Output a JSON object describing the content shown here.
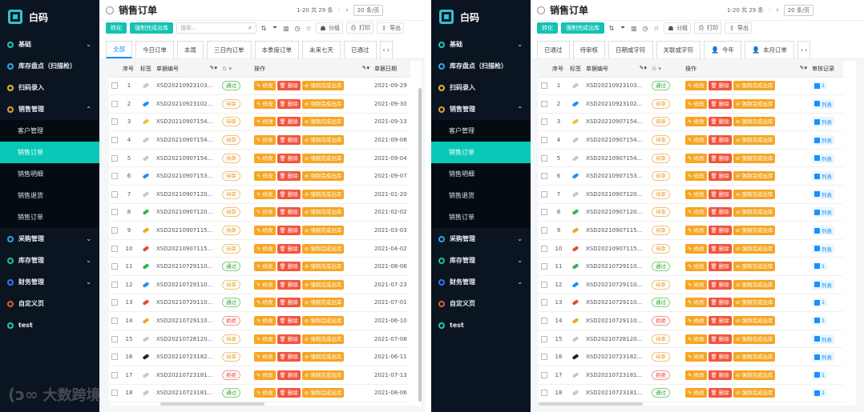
{
  "app": {
    "name": "白码"
  },
  "sidebar": {
    "items": [
      {
        "label": "基础",
        "color": "#23c4c4",
        "chev": "⌄"
      },
      {
        "label": "库存盘点（扫描枪）",
        "color": "#2aa9f0",
        "chev": ""
      },
      {
        "label": "扫码录入",
        "color": "#f0b52a",
        "chev": ""
      },
      {
        "label": "销售管理",
        "color": "#f09a2a",
        "chev": "⌃"
      }
    ],
    "subitems": [
      {
        "label": "客户管理"
      },
      {
        "label": "销售订单"
      },
      {
        "label": "销售明细"
      },
      {
        "label": "销售退货"
      },
      {
        "label": "销售订单"
      }
    ],
    "items2": [
      {
        "label": "采购管理",
        "color": "#2aa9f0",
        "chev": "⌄"
      },
      {
        "label": "库存管理",
        "color": "#23c48a",
        "chev": "⌄"
      },
      {
        "label": "财务管理",
        "color": "#2a7af0",
        "chev": "⌄"
      },
      {
        "label": "自定义页",
        "color": "#f0552a",
        "chev": ""
      },
      {
        "label": "test",
        "color": "#23c4c4",
        "chev": ""
      }
    ]
  },
  "header": {
    "title": "销售订单"
  },
  "pager": {
    "range": "1-20 共 29 条",
    "size": "20 条/页"
  },
  "toolbar": {
    "btn1": "转化",
    "btn2": "强制完成出库",
    "search_placeholder": "搜索...",
    "group": "分组",
    "print": "打印",
    "export": "导出"
  },
  "tabs_left": [
    "全部",
    "今日订单",
    "本周",
    "三日内订单",
    "本季度订单",
    "未来七天",
    "已通过"
  ],
  "tabs_right": [
    "已通过",
    "待审核",
    "日期或字符",
    "关联或字符",
    "今年",
    "本月订单"
  ],
  "columns": {
    "seq": "序号",
    "tag": "标签",
    "no": "单据编号",
    "status": "",
    "ops": "操作",
    "date": "单据日期",
    "audit": "审核记录"
  },
  "actions": {
    "edit": "修改",
    "del": "删除",
    "force": "强制完成出库"
  },
  "statuses": {
    "pass": "通过",
    "pend": "待审",
    "rej": "拒绝"
  },
  "rows": [
    {
      "seq": "1",
      "tag": "#c9c9c9",
      "no": "XSD20210923103...",
      "status": "通过",
      "st": "pass",
      "date": "2021-09-29",
      "audit": "1"
    },
    {
      "seq": "2",
      "tag": "#1890ff",
      "no": "XSD20210923102...",
      "status": "待审",
      "st": "pend",
      "date": "2021-09-30",
      "audit": "列表"
    },
    {
      "seq": "3",
      "tag": "#f0c040",
      "no": "XSD20210907154...",
      "status": "待审",
      "st": "pend",
      "date": "2021-09-13",
      "audit": "列表"
    },
    {
      "seq": "4",
      "tag": "#c9c9c9",
      "no": "XSD20210907154...",
      "status": "待审",
      "st": "pend",
      "date": "2021-09-08",
      "audit": "列表"
    },
    {
      "seq": "5",
      "tag": "#c9c9c9",
      "no": "XSD20210907154...",
      "status": "待审",
      "st": "pend",
      "date": "2021-09-04",
      "audit": "列表"
    },
    {
      "seq": "6",
      "tag": "#1890ff",
      "no": "XSD20210907153...",
      "status": "待审",
      "st": "pend",
      "date": "2021-09-07",
      "audit": "列表"
    },
    {
      "seq": "7",
      "tag": "#c9c9c9",
      "no": "XSD20210907120...",
      "status": "待审",
      "st": "pend",
      "date": "2021-01-20",
      "audit": "列表"
    },
    {
      "seq": "8",
      "tag": "#34b34a",
      "no": "XSD20210907120...",
      "status": "待审",
      "st": "pend",
      "date": "2021-02-02",
      "audit": "列表"
    },
    {
      "seq": "9",
      "tag": "#f5a623",
      "no": "XSD20210907115...",
      "status": "待审",
      "st": "pend",
      "date": "2021-03-03",
      "audit": "列表"
    },
    {
      "seq": "10",
      "tag": "#e84a3a",
      "no": "XSD20210907115...",
      "status": "待审",
      "st": "pend",
      "date": "2021-04-02",
      "audit": "列表"
    },
    {
      "seq": "11",
      "tag": "#34b34a",
      "no": "XSD20210729110...",
      "status": "通过",
      "st": "pass",
      "date": "2021-08-06",
      "audit": "1"
    },
    {
      "seq": "12",
      "tag": "#1890ff",
      "no": "XSD20210729110...",
      "status": "待审",
      "st": "pend",
      "date": "2021-07-23",
      "audit": "列表"
    },
    {
      "seq": "13",
      "tag": "#e84a3a",
      "no": "XSD20210729110...",
      "status": "通过",
      "st": "pass",
      "date": "2021-07-01",
      "audit": "1"
    },
    {
      "seq": "14",
      "tag": "#f5a623",
      "no": "XSD20210729110...",
      "status": "拒绝",
      "st": "rej",
      "date": "2021-06-10",
      "audit": "1"
    },
    {
      "seq": "15",
      "tag": "#c9c9c9",
      "no": "XSD20210728120...",
      "status": "待审",
      "st": "pend",
      "date": "2021-07-08",
      "audit": "列表"
    },
    {
      "seq": "16",
      "tag": "#222222",
      "no": "XSD20210723182...",
      "status": "待审",
      "st": "pend",
      "date": "2021-06-11",
      "audit": "列表"
    },
    {
      "seq": "17",
      "tag": "#c9c9c9",
      "no": "XSD20210723181...",
      "status": "拒绝",
      "st": "rej",
      "date": "2021-07-13",
      "audit": "1"
    },
    {
      "seq": "18",
      "tag": "#c9c9c9",
      "no": "XSD20210723181...",
      "status": "通过",
      "st": "pass",
      "date": "2021-08-06",
      "audit": "1"
    }
  ],
  "watermark": "大数跨境"
}
